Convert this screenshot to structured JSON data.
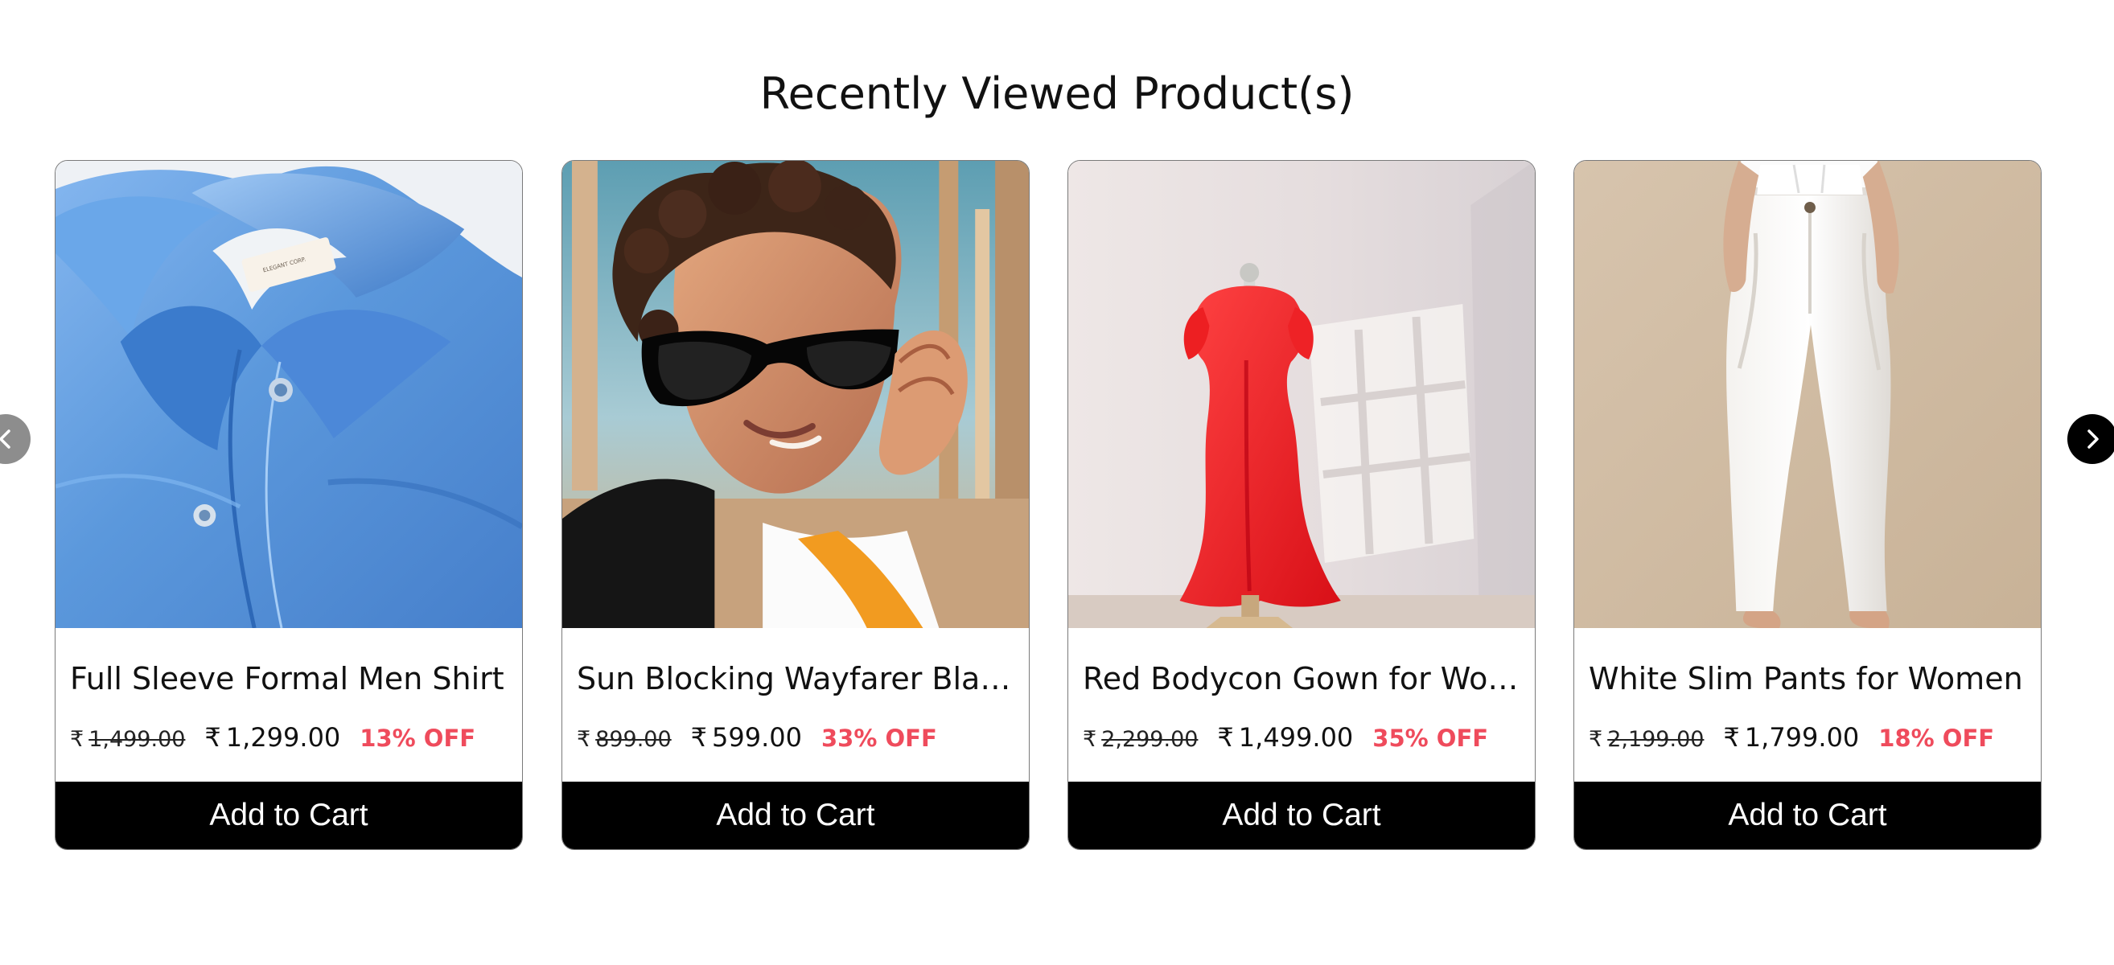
{
  "section": {
    "title": "Recently Viewed Product(s)"
  },
  "carousel": {
    "prev_icon": "chevron-left-icon",
    "next_icon": "chevron-right-icon",
    "prev_color": "#8d8d8d",
    "next_color": "#000000"
  },
  "currency_symbol": "₹",
  "products": [
    {
      "title": "Full Sleeve Formal Men Shirt",
      "mrp": "1,499.00",
      "price": "1,299.00",
      "discount": "13% OFF",
      "button_label": "Add to Cart",
      "image": "blue formal shirt collar"
    },
    {
      "title": "Sun Blocking Wayfarer Black",
      "mrp": "899.00",
      "price": "599.00",
      "discount": "33% OFF",
      "button_label": "Add to Cart",
      "image": "man wearing black wayfarer sunglasses"
    },
    {
      "title": "Red Bodycon Gown for Women",
      "mrp": "2,299.00",
      "price": "1,499.00",
      "discount": "35% OFF",
      "button_label": "Add to Cart",
      "image": "red dress on mannequin"
    },
    {
      "title": "White Slim Pants for Women",
      "mrp": "2,199.00",
      "price": "1,799.00",
      "discount": "18% OFF",
      "button_label": "Add to Cart",
      "image": "white slim pants"
    }
  ],
  "colors": {
    "discount": "#ef4b5c",
    "button_background": "#000000",
    "button_text": "#ffffff"
  }
}
